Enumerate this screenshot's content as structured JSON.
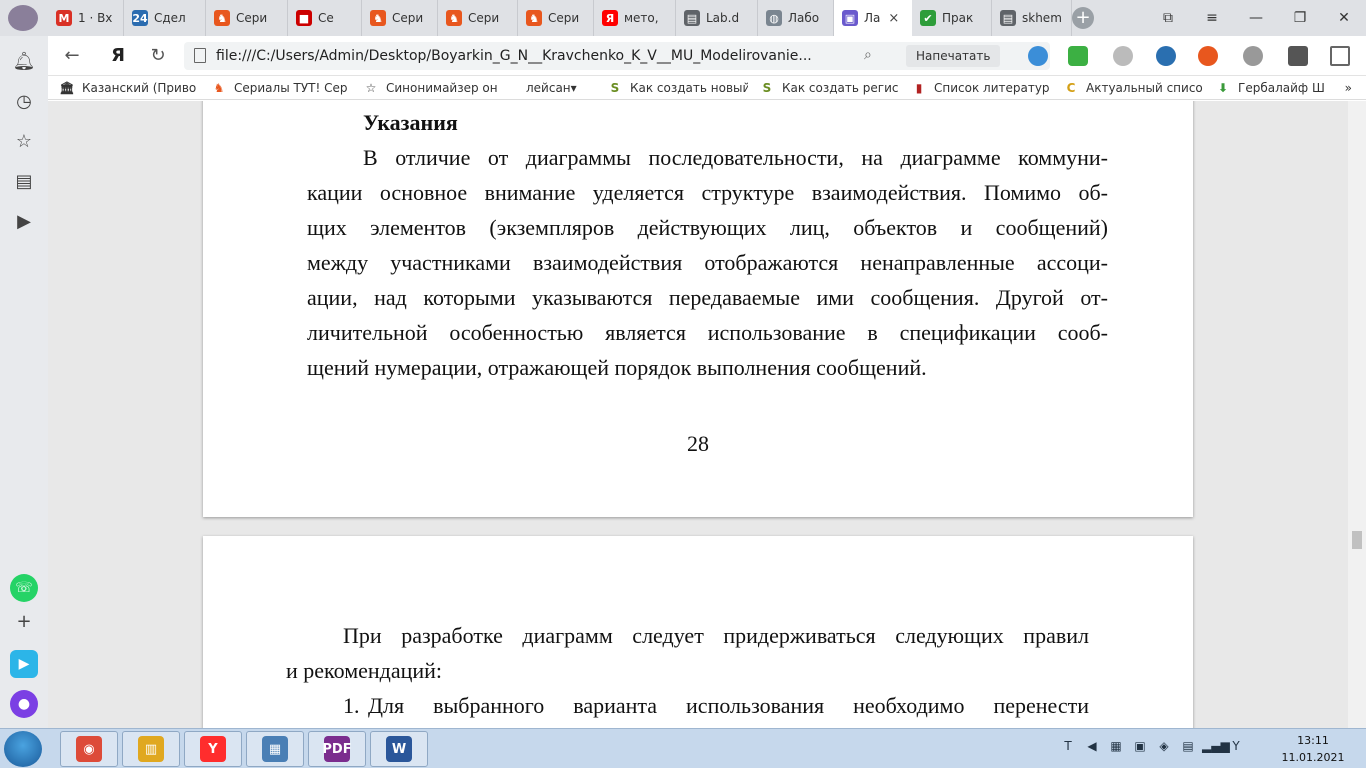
{
  "browser": {
    "tabs": [
      {
        "label": "1 · Вх",
        "icon": "gmail-icon",
        "color": "#d93025",
        "glyph": "M"
      },
      {
        "label": "Сдел",
        "icon": "24-icon",
        "color": "#2b6cb0",
        "glyph": "24"
      },
      {
        "label": "Сери",
        "icon": "cat-icon",
        "color": "#e8571e",
        "glyph": "♞"
      },
      {
        "label": "Се",
        "icon": "video-icon",
        "color": "#cc0000",
        "glyph": "■"
      },
      {
        "label": "Сери",
        "icon": "cat-icon",
        "color": "#e8571e",
        "glyph": "♞"
      },
      {
        "label": "Сери",
        "icon": "cat-icon",
        "color": "#e8571e",
        "glyph": "♞"
      },
      {
        "label": "Сери",
        "icon": "cat-icon",
        "color": "#e8571e",
        "glyph": "♞"
      },
      {
        "label": "мето,",
        "icon": "yandex-icon",
        "color": "#ff0000",
        "glyph": "Я"
      },
      {
        "label": "Lab.d",
        "icon": "document-icon",
        "color": "#5f6368",
        "glyph": "▤"
      },
      {
        "label": "Лабо",
        "icon": "globe-icon",
        "color": "#7a8590",
        "glyph": "◍"
      },
      {
        "label": "Ла",
        "icon": "pdf-icon",
        "color": "#6a5acd",
        "glyph": "▣"
      },
      {
        "label": "Прак",
        "icon": "check-icon",
        "color": "#2e9d3a",
        "glyph": "✔"
      },
      {
        "label": "skhem",
        "icon": "document-icon",
        "color": "#5f6368",
        "glyph": "▤"
      }
    ],
    "tab_close_glyph": "×",
    "new_tab_glyph": "+",
    "address": {
      "url": "file:///C:/Users/Admin/Desktop/Boyarkin_G_N__Kravchenko_K_V__MU_Modelirovanie...",
      "print_label": "Напечатать"
    },
    "bookmarks": [
      {
        "label": "Казанский (Приво",
        "icon": "university-icon",
        "color": "#333",
        "glyph": "🏛"
      },
      {
        "label": "Сериалы ТУТ! Сер",
        "icon": "cat-icon",
        "color": "#e8571e",
        "glyph": "♞"
      },
      {
        "label": "Синонимайзер он",
        "icon": "star-icon",
        "color": "#333",
        "glyph": "☆"
      },
      {
        "label": "лейсан",
        "icon": "folder-icon",
        "color": "#333",
        "glyph": ""
      },
      {
        "label": "Как создать новый",
        "icon": "s-icon",
        "color": "#6b8e23",
        "glyph": "S"
      },
      {
        "label": "Как создать регис",
        "icon": "s-icon",
        "color": "#6b8e23",
        "glyph": "S"
      },
      {
        "label": "Список литератур",
        "icon": "book-icon",
        "color": "#b22222",
        "glyph": "▮"
      },
      {
        "label": "Актуальный списо",
        "icon": "c-icon",
        "color": "#d4a017",
        "glyph": "C"
      },
      {
        "label": "Гербалайф Ш",
        "icon": "leaf-icon",
        "color": "#3a9a3a",
        "glyph": "⬇"
      }
    ]
  },
  "document": {
    "page1": {
      "heading": "Указания",
      "lines": [
        "В отличие от диаграммы последовательности, на диаграмме коммуни-",
        "кации основное внимание уделяется структуре взаимодействия. Помимо об-",
        "щих элементов (экземпляров действующих лиц, объектов и сообщений)",
        "между участниками взаимодействия отображаются ненаправленные ассоци-",
        "ации, над которыми указываются передаваемые ими сообщения. Другой от-",
        "личительной особенностью является использование в спецификации сооб-",
        "щений нумерации, отражающей порядок выполнения сообщений."
      ],
      "page_number": "28"
    },
    "page2": {
      "lines": [
        "При разработке диаграмм следует придерживаться следующих правил",
        "и рекомендаций:",
        "Для выбранного варианта использования необходимо перенести"
      ],
      "list_marker": "1."
    }
  },
  "taskbar": {
    "apps": [
      {
        "icon": "chrome-icon",
        "color": "#dd4b39",
        "glyph": "◉"
      },
      {
        "icon": "explorer-icon",
        "color": "#e0a820",
        "glyph": "▥"
      },
      {
        "icon": "yandex-browser-icon",
        "color": "#ff2d2d",
        "glyph": "Y"
      },
      {
        "icon": "control-panel-icon",
        "color": "#4a7fb5",
        "glyph": "▦"
      },
      {
        "icon": "pdf-editor-icon",
        "color": "#7b2d8e",
        "glyph": "PDF"
      },
      {
        "icon": "word-icon",
        "color": "#2b579a",
        "glyph": "W"
      }
    ],
    "clock": {
      "time": "13:11",
      "date": "11.01.2021"
    }
  }
}
